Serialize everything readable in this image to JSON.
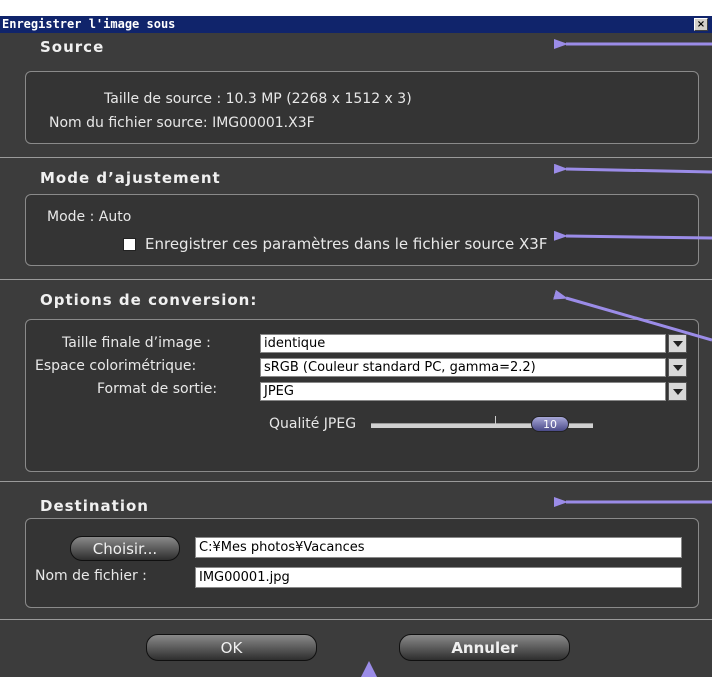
{
  "window": {
    "title": "Enregistrer l'image sous",
    "close_label": "×"
  },
  "source": {
    "title": "Source",
    "size_label": "Taille de source : 10.3 MP (2268 x 1512 x 3)",
    "filename_label": "Nom du fichier source:  IMG00001.X3F"
  },
  "adjust": {
    "title": "Mode d’ajustement",
    "mode_label": "Mode : Auto",
    "save_params_label": "Enregistrer ces paramètres dans le fichier source X3F"
  },
  "conversion": {
    "title": "Options de conversion:",
    "size_label": "Taille finale d’image :",
    "size_value": "identique",
    "colorspace_label": "Espace colorimétrique:",
    "colorspace_value": "sRGB (Couleur standard PC, gamma=2.2)",
    "format_label": "Format de sortie:",
    "format_value": "JPEG",
    "quality_label": "Qualité  JPEG",
    "quality_value": "10"
  },
  "destination": {
    "title": "Destination",
    "choose_label": "Choisir...",
    "path_value": "C:¥Mes photos¥Vacances",
    "filename_label": "Nom de fichier :",
    "filename_value": "IMG00001.jpg"
  },
  "buttons": {
    "ok_label": "OK",
    "cancel_label": "Annuler"
  },
  "colors": {
    "arrow": "#9b8ce8",
    "titlebar": "#10246b",
    "panel": "#3c3c3c"
  }
}
